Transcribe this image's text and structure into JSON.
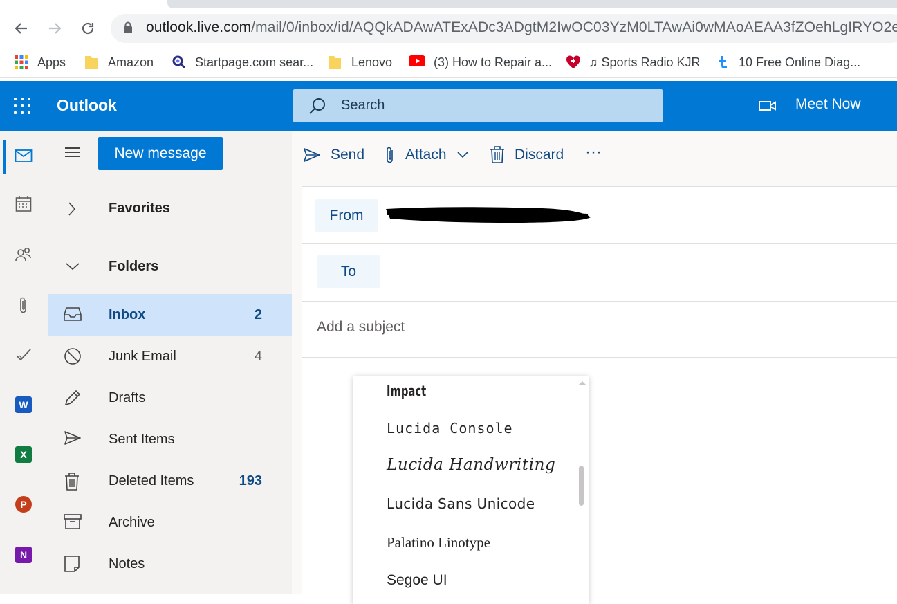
{
  "browser": {
    "url_host": "outlook.live.com",
    "url_rest": "/mail/0/inbox/id/AQQkADAwATExADc3ADgtM2IwOC03YzM0LTAwAi0wMAoAEAA3fZOehLgIRYO2e2...",
    "bookmarks": [
      {
        "label": "Apps",
        "icon": "apps-grid-icon"
      },
      {
        "label": "Amazon",
        "icon": "folder-icon"
      },
      {
        "label": "Startpage.com sear...",
        "icon": "startpage-icon"
      },
      {
        "label": "Lenovo",
        "icon": "folder-icon"
      },
      {
        "label": "(3) How to Repair a...",
        "icon": "youtube-icon"
      },
      {
        "label": "♫ Sports Radio KJR",
        "icon": "iheart-icon"
      },
      {
        "label": "10 Free Online Diag...",
        "icon": "tumblr-icon"
      }
    ]
  },
  "header": {
    "brand": "Outlook",
    "search_placeholder": "Search",
    "meet_now": "Meet Now",
    "accent_color": "#0078d4"
  },
  "folders_pane": {
    "new_message": "New message",
    "favorites": "Favorites",
    "folders_label": "Folders",
    "items": [
      {
        "name": "Inbox",
        "count": "2",
        "selected": true,
        "icon": "inbox-icon"
      },
      {
        "name": "Junk Email",
        "count": "4",
        "icon": "junk-icon"
      },
      {
        "name": "Drafts",
        "count": "",
        "icon": "drafts-pencil-icon"
      },
      {
        "name": "Sent Items",
        "count": "",
        "icon": "sent-icon"
      },
      {
        "name": "Deleted Items",
        "count": "193",
        "icon": "trash-icon"
      },
      {
        "name": "Archive",
        "count": "",
        "icon": "archive-icon"
      },
      {
        "name": "Notes",
        "count": "",
        "icon": "notes-icon"
      }
    ]
  },
  "command_bar": {
    "send": "Send",
    "attach": "Attach",
    "discard": "Discard",
    "more": "···"
  },
  "compose": {
    "from_label": "From",
    "to_label": "To",
    "subject_placeholder": "Add a subject"
  },
  "font_menu": {
    "items": [
      "Impact",
      "Lucida Console",
      "Lucida Handwriting",
      "Lucida Sans Unicode",
      "Palatino Linotype",
      "Segoe UI"
    ]
  }
}
